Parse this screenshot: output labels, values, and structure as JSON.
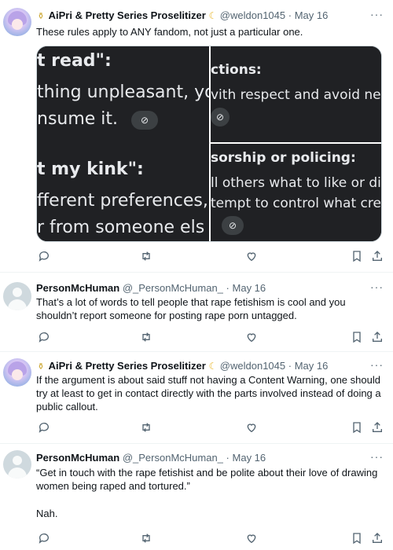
{
  "tweets": [
    {
      "name": "AiPri & Pretty Series Proselitizer",
      "handle": "@weldon1045",
      "date": "May 16",
      "text": "These rules apply to ANY fandom, not just a particular one."
    },
    {
      "name": "PersonMcHuman",
      "handle": "@_PersonMcHuman_",
      "date": "May 16",
      "text": "That’s a lot of words to tell people that rape fetishism is cool and you shouldn’t report someone for posting rape porn untagged."
    },
    {
      "name": "AiPri & Pretty Series Proselitizer",
      "handle": "@weldon1045",
      "date": "May 16",
      "text": "If the argument is about said stuff not having a Content Warning, one should try at least to get in contact directly with the parts involved instead of doing a public callout."
    },
    {
      "name": "PersonMcHuman",
      "handle": "@_PersonMcHuman_",
      "date": "May 16",
      "text": "“Get in touch with the rape fetishist and be polite about their love of drawing women being raped and tortured.”",
      "text2": "Nah."
    }
  ],
  "media": {
    "left_top": [
      "t read\":",
      "thing unpleasant, yo",
      "nsume it."
    ],
    "left_bottom": [
      "t my kink\":",
      "fferent preferences,",
      "r from someone els"
    ],
    "right_top": [
      "ctions:",
      "vith respect and avoid ne"
    ],
    "right_bottom": [
      "sorship or policing:",
      "ll others what to like or di",
      "tempt to control what cre"
    ]
  },
  "ui": {
    "dot": "·",
    "more": "···",
    "link_glyph": "⊘"
  },
  "icons": [
    "reply-icon",
    "retweet-icon",
    "like-icon",
    "bookmark-icon",
    "share-icon",
    "link-icon",
    "more-icon",
    "verified-badge-icon",
    "moon-icon"
  ]
}
